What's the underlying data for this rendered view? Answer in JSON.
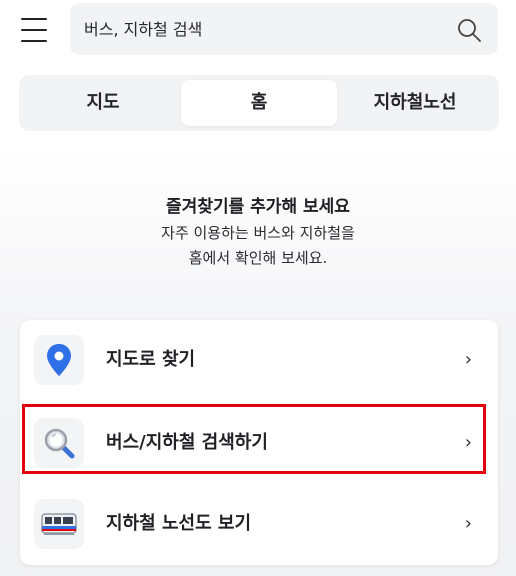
{
  "search": {
    "placeholder": "버스, 지하철 검색"
  },
  "tabs": [
    {
      "label": "지도"
    },
    {
      "label": "홈",
      "selected": true
    },
    {
      "label": "지하철노선"
    }
  ],
  "empty_state": {
    "title": "즐겨찾기를 추가해 보세요",
    "line1": "자주 이용하는 버스와 지하철을",
    "line2": "홈에서 확인해 보세요."
  },
  "shortcuts": [
    {
      "label": "지도로 찾기",
      "icon": "location-pin-icon",
      "chevron": "›"
    },
    {
      "label": "버스/지하철 검색하기",
      "icon": "magnifier-icon",
      "chevron": "›",
      "highlighted": true
    },
    {
      "label": "지하철 노선도 보기",
      "icon": "subway-train-icon",
      "chevron": "›"
    }
  ],
  "colors": {
    "highlight": "#e3000f",
    "pin": "#2f6fe8",
    "background": "#f2f3f5"
  }
}
